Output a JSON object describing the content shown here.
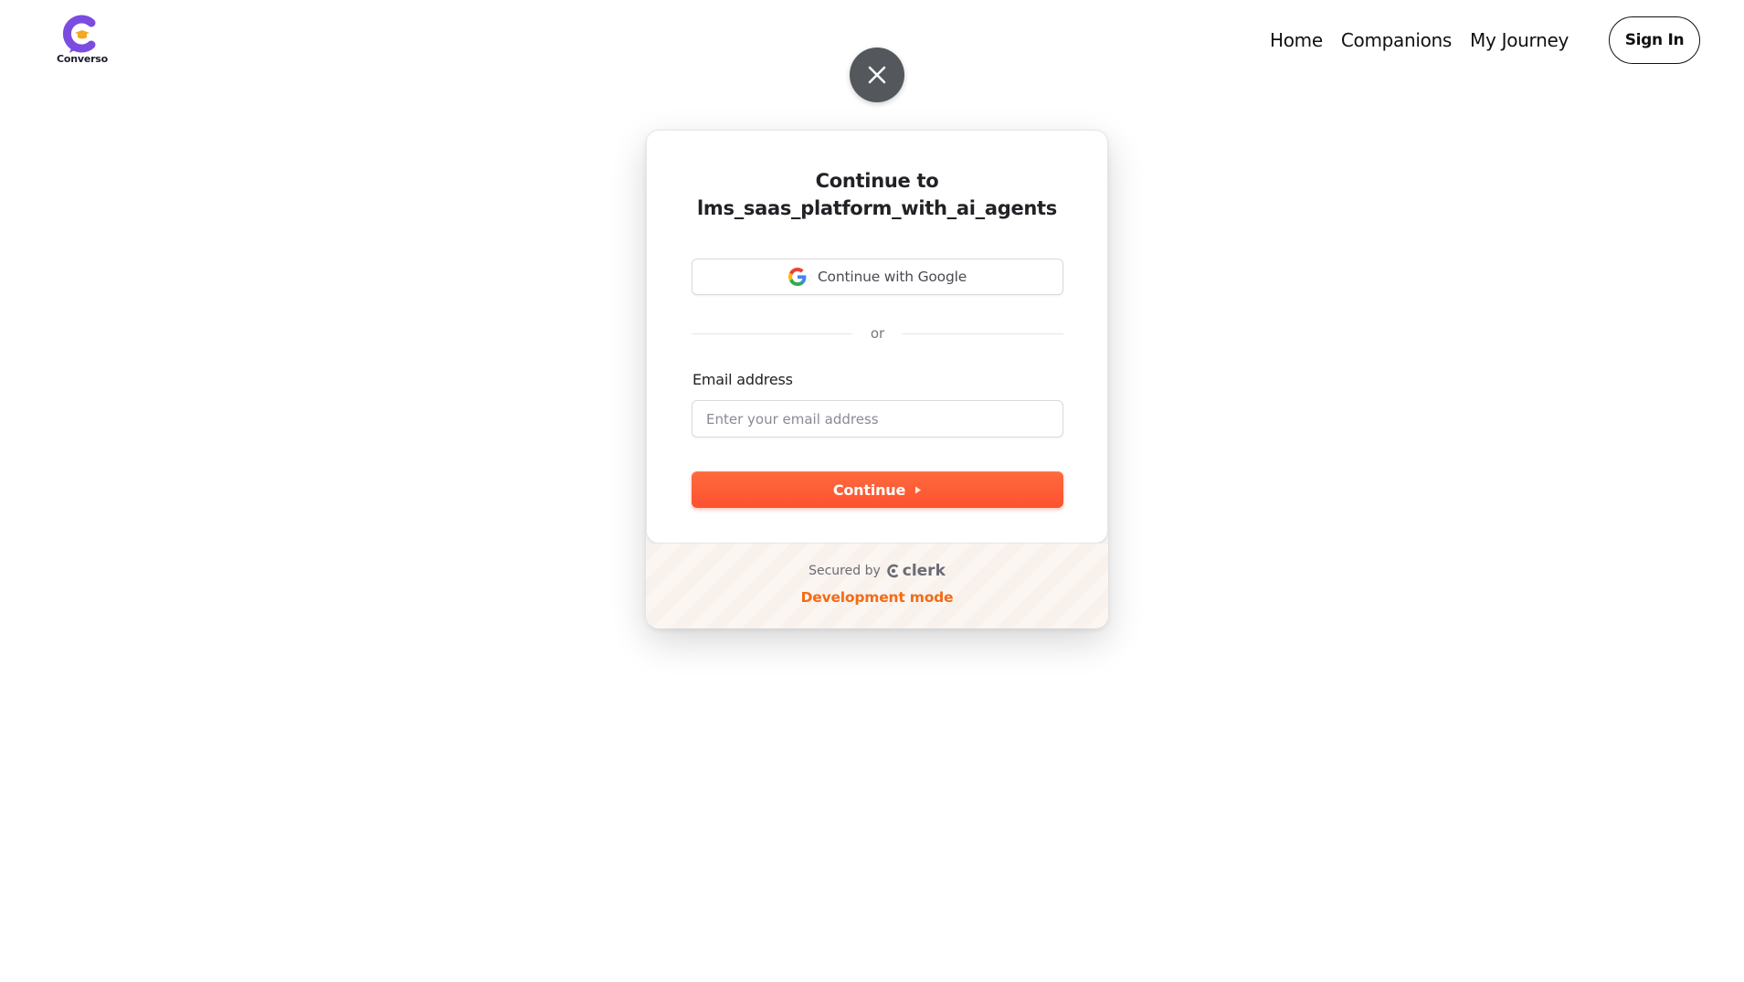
{
  "header": {
    "brand_name": "Converso",
    "nav": [
      "Home",
      "Companions",
      "My Journey"
    ],
    "sign_in_label": "Sign In"
  },
  "modal": {
    "title_line1": "Continue to",
    "title_line2": "lms_saas_platform_with_ai_agents",
    "google_button_label": "Continue with Google",
    "divider_text": "or",
    "email_label": "Email address",
    "email_placeholder": "Enter your email address",
    "email_value": "",
    "continue_label": "Continue",
    "secured_by_label": "Secured by",
    "secured_by_brand": "clerk",
    "dev_mode_label": "Development mode"
  },
  "colors": {
    "brand_purple": "#7b4ce0",
    "accent_orange": "#fc5230",
    "dev_mode_orange": "#f36b16",
    "close_button_gray": "#54575c"
  },
  "icons": {
    "close": "close-icon",
    "google": "google-icon",
    "continue": "play-arrow-icon",
    "clerk": "clerk-logo-icon"
  }
}
